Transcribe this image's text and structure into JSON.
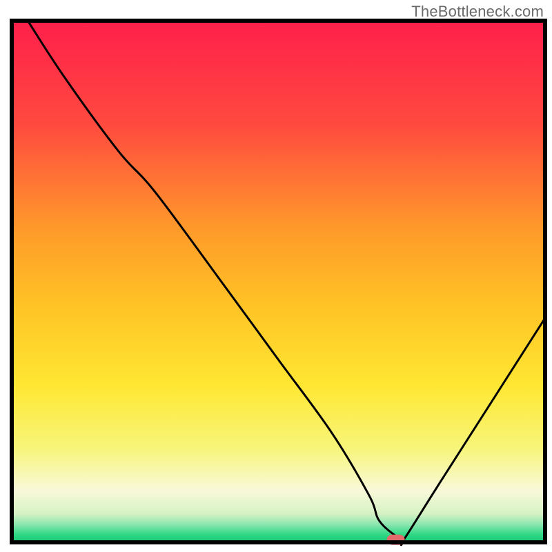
{
  "watermark": "TheBottleneck.com",
  "chart_data": {
    "type": "line",
    "title": "",
    "xlabel": "",
    "ylabel": "",
    "xlim": [
      0,
      100
    ],
    "ylim": [
      0,
      100
    ],
    "grid": false,
    "legend": false,
    "series": [
      {
        "name": "curve",
        "x": [
          3,
          10,
          20,
          27,
          40,
          50,
          60,
          67,
          69,
          73,
          73.5,
          80,
          90,
          100
        ],
        "y": [
          100,
          89,
          75,
          67,
          49,
          35,
          21,
          9,
          4,
          0.5,
          0.5,
          11,
          27,
          43
        ]
      }
    ],
    "marker": {
      "x": 72,
      "y": 0.5,
      "color": "#e36a6a"
    },
    "background": {
      "type": "vertical-gradient",
      "stops": [
        {
          "pos": 0.0,
          "color": "#ff1f4b"
        },
        {
          "pos": 0.2,
          "color": "#ff4a3f"
        },
        {
          "pos": 0.4,
          "color": "#ff9a2a"
        },
        {
          "pos": 0.55,
          "color": "#ffc425"
        },
        {
          "pos": 0.7,
          "color": "#ffe733"
        },
        {
          "pos": 0.82,
          "color": "#f7f57a"
        },
        {
          "pos": 0.9,
          "color": "#f9f9d9"
        },
        {
          "pos": 0.945,
          "color": "#d6f2c5"
        },
        {
          "pos": 0.965,
          "color": "#8ee6b0"
        },
        {
          "pos": 0.985,
          "color": "#2fd885"
        },
        {
          "pos": 1.0,
          "color": "#18c877"
        }
      ]
    }
  }
}
